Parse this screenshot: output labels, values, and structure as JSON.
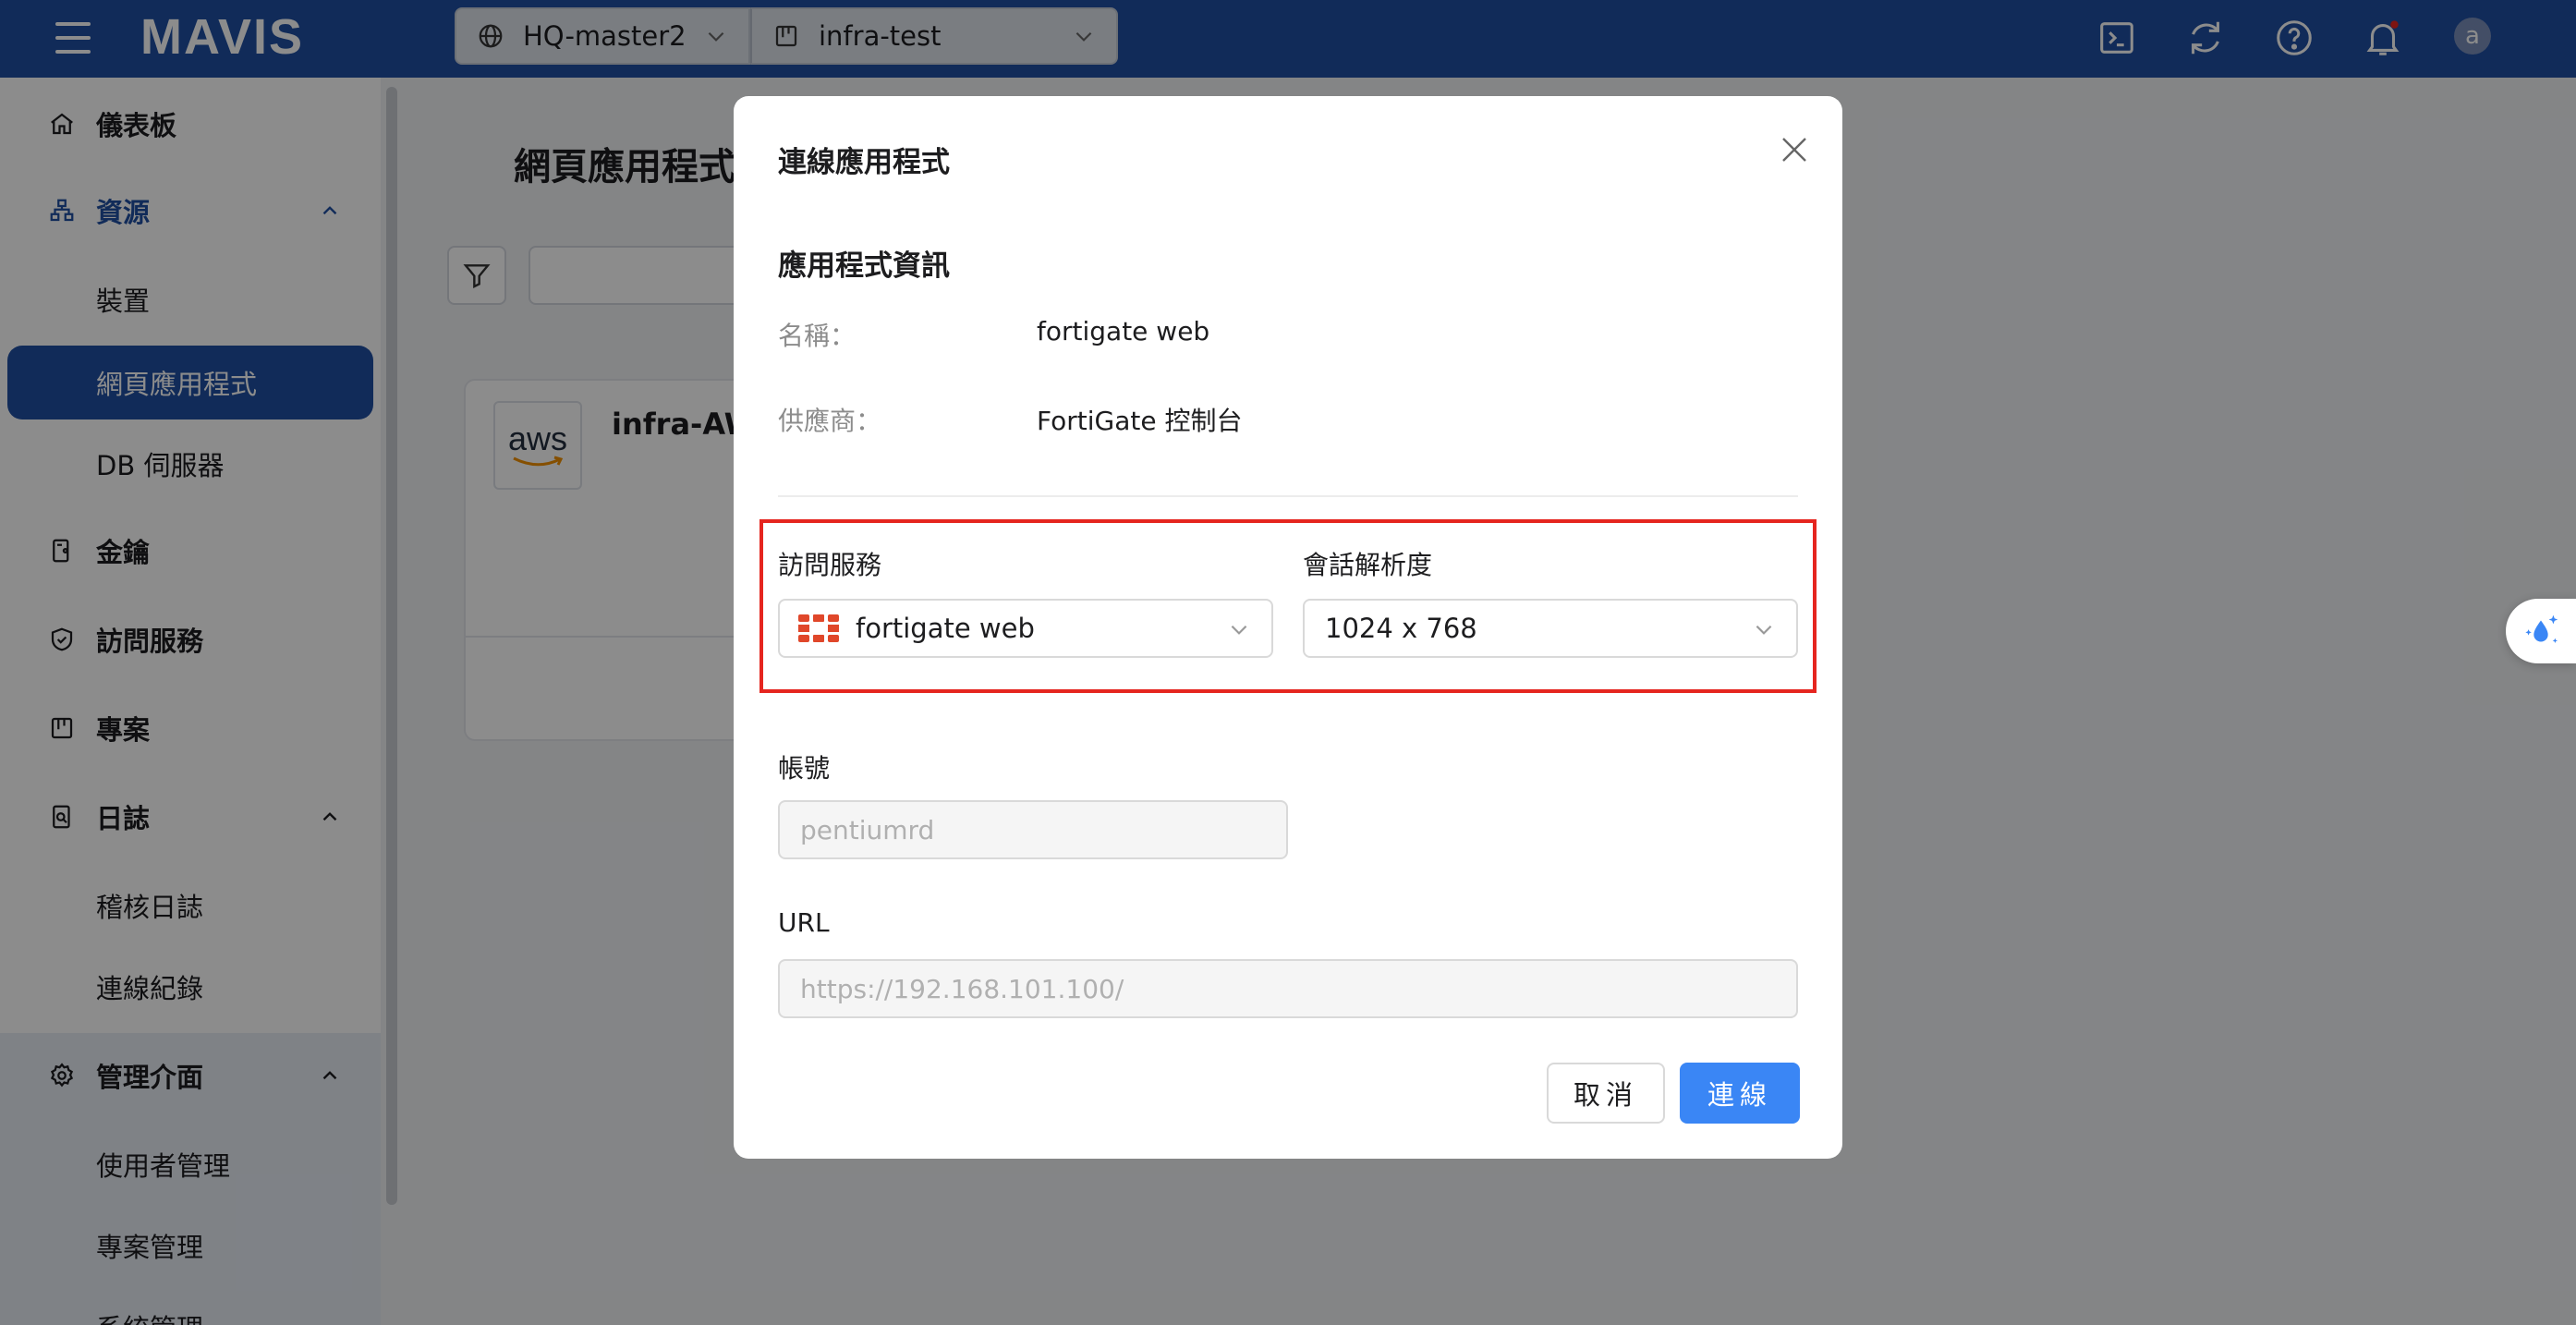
{
  "app": {
    "logo": "MAVIS"
  },
  "topbar": {
    "site_selector": "HQ-master2",
    "project_selector": "infra-test",
    "avatar_letter": "a",
    "icons": [
      "terminal-icon",
      "refresh-icon",
      "help-icon",
      "bell-icon"
    ]
  },
  "sidebar": {
    "items": [
      {
        "label": "儀表板",
        "icon": "home-icon"
      },
      {
        "label": "資源",
        "icon": "sitemap-icon"
      },
      {
        "label": "裝置"
      },
      {
        "label": "網頁應用程式"
      },
      {
        "label": "DB 伺服器"
      },
      {
        "label": "金鑰",
        "icon": "key-icon"
      },
      {
        "label": "訪問服務",
        "icon": "shield-icon"
      },
      {
        "label": "專案",
        "icon": "project-icon"
      },
      {
        "label": "日誌",
        "icon": "log-icon"
      },
      {
        "label": "稽核日誌"
      },
      {
        "label": "連線紀錄"
      },
      {
        "label": "管理介面",
        "icon": "gear-icon"
      },
      {
        "label": "使用者管理"
      },
      {
        "label": "專案管理"
      },
      {
        "label": "系統管理"
      }
    ]
  },
  "main": {
    "title": "網頁應用程式",
    "card_title": "infra-AWS",
    "card_logo": "aws"
  },
  "modal": {
    "title": "連線應用程式",
    "section_title": "應用程式資訊",
    "name_label": "名稱：",
    "name_value": "fortigate web",
    "provider_label": "供應商：",
    "provider_value": "FortiGate 控制台",
    "access_service_label": "訪問服務",
    "access_service_value": "fortigate web",
    "resolution_label": "會話解析度",
    "resolution_value": "1024 x 768",
    "account_label": "帳號",
    "account_value": "pentiumrd",
    "url_label": "URL",
    "url_value": "https://192.168.101.100/",
    "cancel_label": "取消",
    "connect_label": "連線"
  },
  "colors": {
    "brand": "#1f4fa3",
    "primary_button": "#3a86f5",
    "highlight": "#e5251f",
    "fortinet": "#e0472a"
  }
}
